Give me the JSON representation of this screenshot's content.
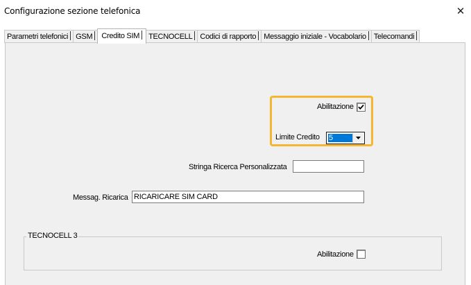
{
  "window": {
    "title": "Configurazione sezione telefonica",
    "close_glyph": "✕"
  },
  "tabs": [
    {
      "label": "Parametri telefonici",
      "selected": false
    },
    {
      "label": "GSM",
      "selected": false
    },
    {
      "label": "Credito SIM",
      "selected": true
    },
    {
      "label": "TECNOCELL",
      "selected": false
    },
    {
      "label": "Codici di rapporto",
      "selected": false
    },
    {
      "label": "Messaggio iniziale - Vocabolario",
      "selected": false
    },
    {
      "label": "Telecomandi",
      "selected": false
    }
  ],
  "credito_sim": {
    "abilitazione_label": "Abilitazione",
    "abilitazione_checked": true,
    "limite_credito_label": "Limite Credito",
    "limite_credito_value": "5",
    "stringa_ricerca_label": "Stringa Ricerca Personalizzata",
    "stringa_ricerca_value": "",
    "messag_ricarica_label": "Messag. Ricarica",
    "messag_ricarica_value": "RICARICARE  SIM CARD"
  },
  "tecnocell3": {
    "group_label": "TECNOCELL 3",
    "abilitazione_label": "Abilitazione",
    "abilitazione_checked": false
  },
  "colors": {
    "highlight_border": "#f5b731",
    "selection_blue": "#0078d7",
    "panel_bg": "#f0f0f0"
  },
  "icons": {
    "close": "close-icon",
    "dropdown": "chevron-down-icon",
    "check": "check-icon"
  }
}
